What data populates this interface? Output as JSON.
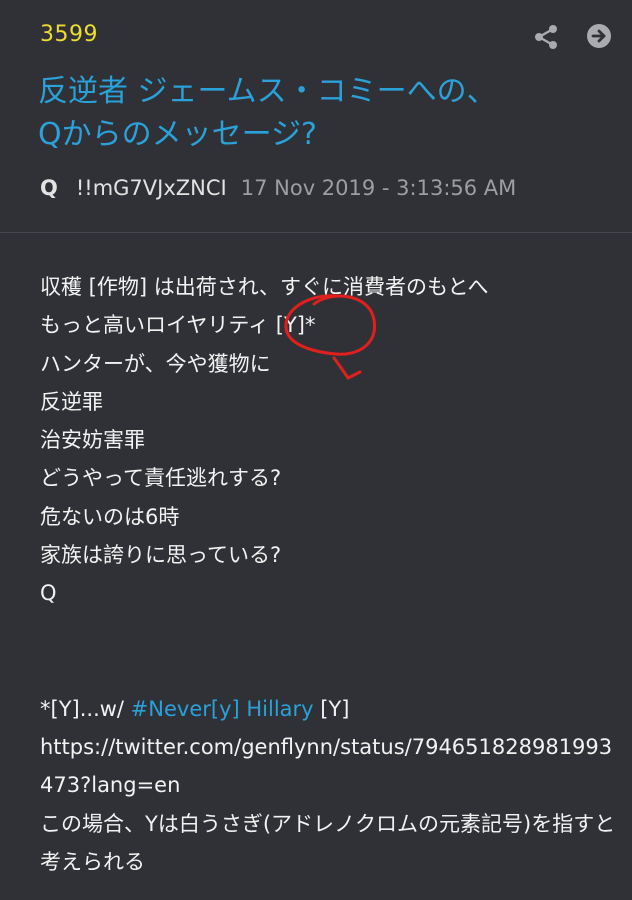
{
  "post": {
    "number": "3599",
    "title": "反逆者 ジェームス・コミーへの、\nQからのメッセージ?",
    "author": "Q",
    "tripcode": "!!mG7VJxZNCI",
    "date": "17 Nov 2019 - 3:13:56 AM"
  },
  "icons": {
    "share": "share-icon",
    "next": "arrow-right-circle-icon",
    "annotation": "red-hand-drawn-circle-arrow"
  },
  "body": {
    "lines": [
      "収穫 [作物] は出荷され、すぐに消費者のもとへ",
      "もっと高いロイヤリティ [Y]*",
      "ハンターが、今や獲物に",
      "反逆罪",
      "治安妨害罪",
      "どうやって責任逃れする?",
      "危ないのは6時",
      "家族は誇りに思っている?",
      "Q"
    ],
    "footnote_prefix": "*[Y]...w/ ",
    "hashtag": "#Never[y] Hillary",
    "footnote_suffix": " [Y]",
    "url": " https://twitter.com/genflynn/status/794651828981993473?lang=en",
    "note": "この場合、Yは白うさぎ(アドレノクロムの元素記号)を指すと考えられる"
  },
  "colors": {
    "background": "#2f3137",
    "post_number": "#eedd2e",
    "accent_link": "#2aa1d9",
    "text": "#f2f2f2",
    "muted": "#9c9ea3",
    "annotation": "#e0201c"
  }
}
